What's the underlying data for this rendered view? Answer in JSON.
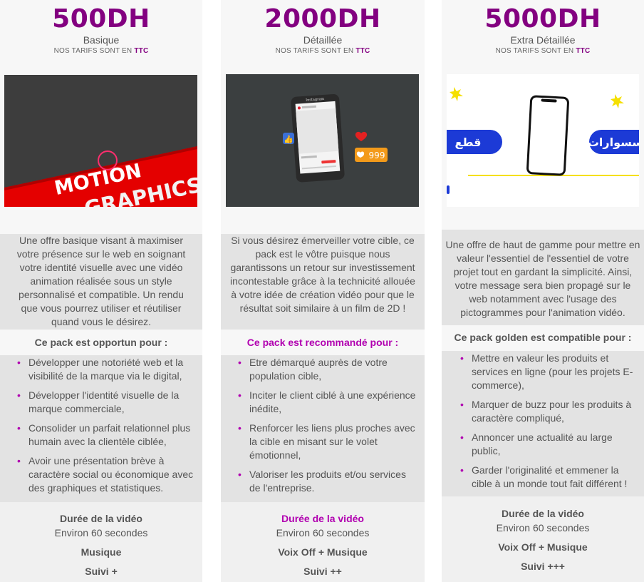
{
  "plans": [
    {
      "price": "500DH",
      "subtitle": "Basique",
      "tarifs_prefix": "NOS TARIFS SONT EN",
      "tarifs_suffix": "TTC",
      "media": {
        "title_line1": "MOTION",
        "title_line2": "GRAPHICS"
      },
      "description": "Une offre basique visant à maximiser votre présence sur le web en soignant votre identité visuelle avec une vidéo animation réalisée sous un style personnalisé et compatible. Un rendu que vous pourrez utiliser et réutiliser quand vous le désirez.",
      "section_title": "Ce pack est opportun pour :",
      "bullets": [
        "Développer une notoriété web et la visibilité de la marque via le digital,",
        "Développer l'identité visuelle de la marque commerciale,",
        "Consolider un parfait relationnel plus humain avec la clientèle ciblée,",
        "Avoir une présentation brève à caractère social ou économique avec des graphiques et statistiques."
      ],
      "duration_label": "Durée de la vidéo",
      "duration_value": "Environ 60 secondes",
      "audio": "Musique",
      "suivi": "Suivi +"
    },
    {
      "price": "2000DH",
      "subtitle": "Détaillée",
      "tarifs_prefix": "NOS TARIFS SONT EN",
      "tarifs_suffix": "TTC",
      "media": {
        "likes": "999",
        "app_name": "Instagram"
      },
      "description": "Si vous désirez émerveiller votre cible, ce pack est le vôtre puisque nous garantissons un retour sur investissement incontestable grâce à la technicité allouée à votre idée de création vidéo pour que le résultat soit similaire à un film de 2D !",
      "section_title": "Ce pack est recommandé pour :",
      "bullets": [
        "Etre démarqué auprès de votre population cible,",
        "Inciter le client ciblé à une expérience inédite,",
        "Renforcer les liens plus proches avec la cible en misant sur le volet émotionnel,",
        "Valoriser les produits et/ou services de l'entreprise."
      ],
      "duration_label": "Durée de la vidéo",
      "duration_value": "Environ 60 secondes",
      "audio": "Voix Off + Musique",
      "suivi": "Suivi ++"
    },
    {
      "price": "5000DH",
      "subtitle": "Extra Détaillée",
      "tarifs_prefix": "NOS TARIFS SONT EN",
      "tarifs_suffix": "TTC",
      "media": {
        "left_word": "قطع",
        "right_word": "سسوارات"
      },
      "description": "Une offre de haut de gamme pour mettre en valeur l'essentiel de l'essentiel de votre projet tout en gardant la simplicité. Ainsi, votre message sera bien propagé sur le web notamment avec l'usage des pictogrammes pour l'animation vidéo.",
      "section_title": "Ce pack golden est compatible pour :",
      "bullets": [
        "Mettre en valeur les produits et services en ligne (pour les projets E-commerce),",
        "Marquer de buzz pour les produits à caractère compliqué,",
        "Annoncer une actualité au large public,",
        "Garder l'originalité et emmener la cible à un monde tout fait différent !"
      ],
      "duration_label": "Durée de la vidéo",
      "duration_value": "Environ 60 secondes",
      "audio": "Voix Off + Musique",
      "suivi": "Suivi +++"
    }
  ],
  "colors": {
    "accent": "#830080",
    "bullet": "#b000b0",
    "text": "#555555",
    "band": "#e3e3e3"
  }
}
